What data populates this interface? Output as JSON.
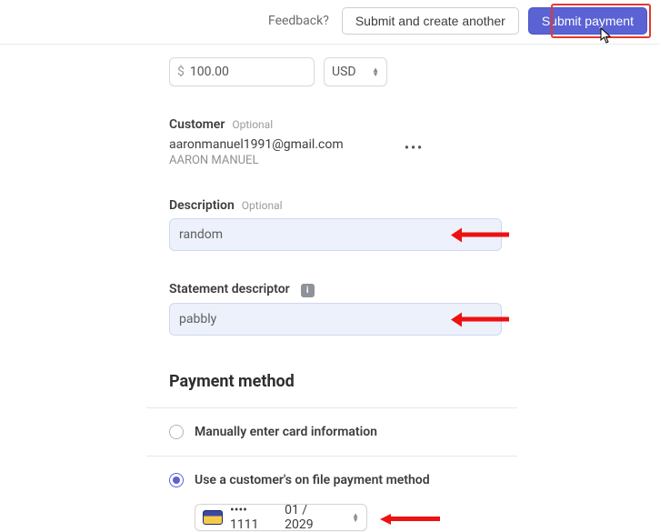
{
  "topbar": {
    "feedback": "Feedback?",
    "submit_another": "Submit and create another",
    "submit_payment": "Submit payment"
  },
  "amount": {
    "symbol": "$",
    "value": "100.00",
    "currency": "USD"
  },
  "customer": {
    "label": "Customer",
    "optional": "Optional",
    "email": "aaronmanuel1991@gmail.com",
    "name": "AARON MANUEL"
  },
  "description": {
    "label": "Description",
    "optional": "Optional",
    "value": "random"
  },
  "statement": {
    "label": "Statement descriptor",
    "value": "pabbly"
  },
  "payment_method": {
    "heading": "Payment method",
    "option_manual": "Manually enter card information",
    "option_on_file": "Use a customer's on file payment method",
    "selected": "on_file",
    "card": {
      "masked": "•••• 1111",
      "expiry": "01 / 2029"
    }
  }
}
